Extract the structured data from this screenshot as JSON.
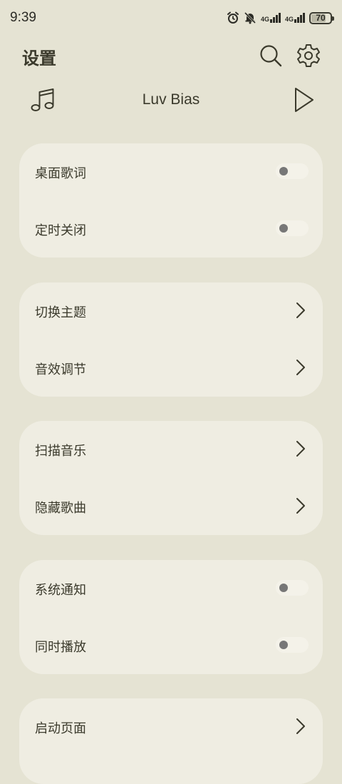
{
  "status": {
    "time": "9:39",
    "net1": "4G",
    "net2": "4G",
    "battery": "70"
  },
  "header": {
    "title": "设置"
  },
  "now_playing": {
    "title": "Luv Bias"
  },
  "groups": [
    {
      "items": [
        {
          "label": "桌面歌词",
          "control": "toggle",
          "on": false
        },
        {
          "label": "定时关闭",
          "control": "toggle",
          "on": false
        }
      ]
    },
    {
      "items": [
        {
          "label": "切换主题",
          "control": "chevron"
        },
        {
          "label": "音效调节",
          "control": "chevron"
        }
      ]
    },
    {
      "items": [
        {
          "label": "扫描音乐",
          "control": "chevron"
        },
        {
          "label": "隐藏歌曲",
          "control": "chevron"
        }
      ]
    },
    {
      "items": [
        {
          "label": "系统通知",
          "control": "toggle",
          "on": false
        },
        {
          "label": "同时播放",
          "control": "toggle",
          "on": false
        }
      ]
    },
    {
      "items": [
        {
          "label": "启动页面",
          "control": "chevron"
        }
      ]
    }
  ],
  "colors": {
    "background": "#e5e3d3",
    "card": "#efede2",
    "text": "#3b3a2c",
    "knob": "#777777"
  },
  "icons": [
    "music-note-icon",
    "search-icon",
    "gear-icon",
    "play-icon",
    "chevron-right-icon",
    "alarm-icon",
    "mute-bell-icon"
  ]
}
